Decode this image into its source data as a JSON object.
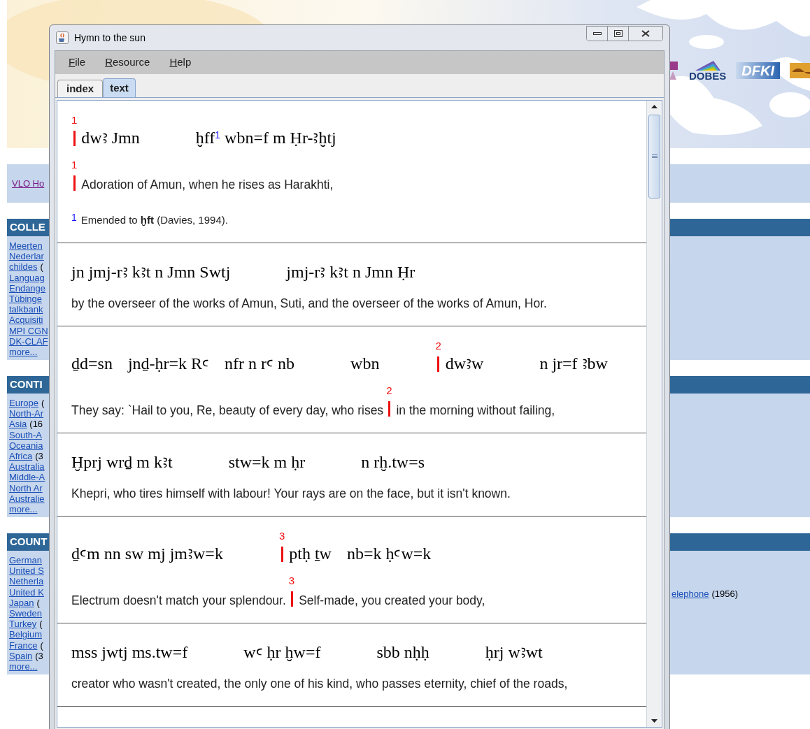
{
  "page": {
    "nav_link": "VLO Ho",
    "logos": [
      {
        "kind": "crest"
      },
      {
        "kind": "dobes",
        "text": "DOBES"
      },
      {
        "kind": "dfki",
        "text": "DFKI"
      },
      {
        "kind": "orange"
      }
    ],
    "sections": [
      {
        "heading": "COLLE",
        "links": [
          {
            "text": "Meerten"
          },
          {
            "text": "Nederlar"
          },
          {
            "text": "childes",
            "rest": "("
          },
          {
            "text": "Languag"
          },
          {
            "text": "Endange"
          },
          {
            "text": "Tübinge"
          },
          {
            "text": "talkbank"
          },
          {
            "text": "Acquisiti"
          },
          {
            "text": "MPI CGN"
          },
          {
            "text": "DK-CLAF"
          },
          {
            "text": "more..."
          }
        ]
      },
      {
        "heading": "CONTI",
        "links": [
          {
            "text": "Europe",
            "rest": "("
          },
          {
            "text": "North-Ar"
          },
          {
            "text": "Asia",
            "rest": "(16"
          },
          {
            "text": "South-A"
          },
          {
            "text": "Oceania"
          },
          {
            "text": "Africa",
            "rest": "(3"
          },
          {
            "text": "Australia"
          },
          {
            "text": "Middle-A"
          },
          {
            "text": "North Ar"
          },
          {
            "text": "Australie"
          },
          {
            "text": "more..."
          }
        ]
      },
      {
        "heading": "COUNT",
        "links": [
          {
            "text": "German"
          },
          {
            "text": "United S"
          },
          {
            "text": "Netherla"
          },
          {
            "text": "United K"
          },
          {
            "text": "Japan",
            "rest": "("
          },
          {
            "text": "Sweden"
          },
          {
            "text": "Turkey",
            "rest": "("
          },
          {
            "text": "Belgium"
          },
          {
            "text": "France",
            "rest": "("
          },
          {
            "text": "Spain",
            "rest": "(3"
          },
          {
            "text": "more..."
          }
        ],
        "extra": {
          "link": "elephone",
          "rest": "(1956)"
        }
      }
    ]
  },
  "window": {
    "title": "Hymn to the sun",
    "menu": [
      "File",
      "Resource",
      "Help"
    ],
    "tabs": [
      {
        "label": "index",
        "selected": false
      },
      {
        "label": "text",
        "selected": true
      }
    ],
    "blocks": [
      {
        "translit": [
          [
            {
              "text": "dwꜣ Jmn",
              "marker": "1"
            }
          ],
          [
            {
              "text": "ḫff$^{1}$ wbn=f m Ḥr-ꜣḫtj"
            }
          ]
        ],
        "translation": [
          {
            "text": "Adoration of Amun, when he rises as Harakhti,",
            "marker": "1"
          }
        ],
        "note": {
          "mark": "1",
          "text": "Emended to **ḫft** (Davies, 1994)."
        }
      },
      {
        "translit": [
          [
            {
              "text": "jn jmj-rꜣ kꜣt n Jmn Swtj"
            }
          ],
          [
            {
              "text": "jmj-rꜣ kꜣt n Jmn Ḥr"
            }
          ]
        ],
        "translation": [
          {
            "text": "by the overseer of the works of Amun, Suti, and the overseer of the works of Amun, Hor."
          }
        ]
      },
      {
        "translit": [
          [
            {
              "text": "ḏd=sn"
            },
            {
              "text": "jnḏ-ḥr=k Rꜥ"
            },
            {
              "text": "nfr n rꜥ nb"
            }
          ],
          [
            {
              "text": "wbn"
            }
          ],
          [
            {
              "text": "dwꜣw",
              "marker": "2"
            }
          ],
          [
            {
              "text": "n jr=f ꜣbw"
            }
          ]
        ],
        "translation": [
          {
            "text": "They say: `Hail to you, Re, beauty of every day, who rises"
          },
          {
            "text": "in the morning without failing,",
            "marker": "2"
          }
        ]
      },
      {
        "translit": [
          [
            {
              "text": "Ḫprj wrḏ m kꜣt"
            }
          ],
          [
            {
              "text": "stw=k m ḥr"
            }
          ],
          [
            {
              "text": "n rḫ.tw=s"
            }
          ]
        ],
        "translation": [
          {
            "text": "Khepri, who tires himself with labour! Your rays are on the face, but it isn't known."
          }
        ]
      },
      {
        "translit": [
          [
            {
              "text": "ḏꜥm nn sw mj jmꜣw=k"
            }
          ],
          [
            {
              "text": "ptḥ ṯw",
              "marker": "3"
            },
            {
              "text": "nb=k ḥꜥw=k"
            }
          ]
        ],
        "translation": [
          {
            "text": "Electrum doesn't match your splendour."
          },
          {
            "text": "Self-made, you created your body,",
            "marker": "3"
          }
        ]
      },
      {
        "translit": [
          [
            {
              "text": "mss jwtj ms.tw=f"
            }
          ],
          [
            {
              "text": "wꜥ ḥr ḫw=f"
            }
          ],
          [
            {
              "text": "sbb nḥḥ"
            }
          ],
          [
            {
              "text": "ḥrj wꜣwt"
            }
          ]
        ],
        "translation": [
          {
            "text": "creator who wasn't created, the only one of his kind, who passes eternity, chief of the roads,"
          }
        ]
      }
    ]
  }
}
